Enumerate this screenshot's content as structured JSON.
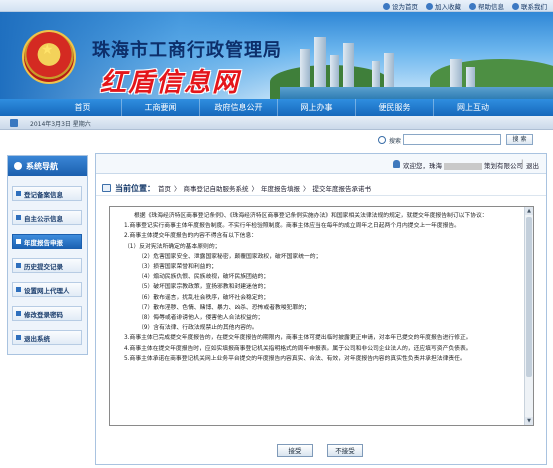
{
  "toplinks": [
    {
      "icon": "home-icon",
      "label": "设为首页"
    },
    {
      "icon": "star-icon",
      "label": "加入收藏"
    },
    {
      "icon": "help-icon",
      "label": "帮助信息"
    },
    {
      "icon": "contact-icon",
      "label": "联系我们"
    }
  ],
  "banner": {
    "bureau_title": "珠海市工商行政管理局",
    "site_title": "红盾信息网"
  },
  "nav": [
    "首页",
    "工商要闻",
    "政府信息公开",
    "网上办事",
    "便民服务",
    "网上互动"
  ],
  "date_text": "2014年3月3日 星期六",
  "search": {
    "label": "搜索",
    "button": "搜 索"
  },
  "sidebar": {
    "title": "系统导航",
    "items": [
      {
        "label": "登记备案信息",
        "active": false
      },
      {
        "label": "自主公示信息",
        "active": false
      },
      {
        "label": "年度报告申报",
        "active": true
      },
      {
        "label": "历史提交记录",
        "active": false
      },
      {
        "label": "设置网上代理人",
        "active": false
      },
      {
        "label": "修改登录密码",
        "active": false
      },
      {
        "label": "退出系统",
        "active": false
      }
    ]
  },
  "welcome": {
    "prefix": "欢迎您，珠海",
    "suffix": "策划有限公司",
    "separator": "|",
    "logout": "退出"
  },
  "breadcrumb": {
    "label": "当前位置：",
    "items": [
      "首页",
      "商事登记自助服务系统",
      "年度报告填报",
      "提交年度报告承诺书"
    ],
    "separator": "〉"
  },
  "notice": {
    "lines": [
      {
        "level": 0,
        "text": "根据《珠海经济特区商事登记条例》、《珠海经济特区商事登记条例实施办法》和国家相关法律法规的规定，就提交年度报告制订以下协议："
      },
      {
        "level": 1,
        "text": "1.商事登记实行商事主体年度报告制度。不实行年检验照制度。商事主体应当在每年的成立周年之日起两个月内提交上一年度报告。"
      },
      {
        "level": 1,
        "text": "2.商事主体提交年度报告的内容不得含有以下信息："
      },
      {
        "level": 1,
        "text": "（1）反对宪法所确定的基本原则的；"
      },
      {
        "level": 2,
        "text": "（2）危害国家安全、泄露国家秘密，颠覆国家政权，破坏国家统一的；"
      },
      {
        "level": 2,
        "text": "（3）损害国家荣誉和利益的；"
      },
      {
        "level": 2,
        "text": "（4）煽动民族仇恨、民族歧视，破坏民族团结的；"
      },
      {
        "level": 2,
        "text": "（5）破坏国家宗教政策，宣扬邪教和封建迷信的；"
      },
      {
        "level": 2,
        "text": "（6）散布谣言，扰乱社会秩序，破坏社会稳定的；"
      },
      {
        "level": 2,
        "text": "（7）散布淫秽、色情、赌博、暴力、凶杀、恐怖或者教唆犯罪的；"
      },
      {
        "level": 2,
        "text": "（8）侮辱或者诽谤他人，侵害他人合法权益的；"
      },
      {
        "level": 2,
        "text": "（9）含有法律、行政法规禁止的其他内容的。"
      },
      {
        "level": 1,
        "text": "3.商事主体已完成提交年度报告的，在提交年度报告的期限内，商事主体可提出临时披露更正申请，对本年已提交的年度报告进行修正。"
      },
      {
        "level": 1,
        "text": "4.商事主体在提交年度报告时，应如实填报商事登记机关指明格式的周年申报表。属于公司和非公司企业法人的，还应填写资产负债表。"
      },
      {
        "level": 1,
        "text": "5.商事主体承诺在商事登记机关网上业务平台提交的年度报告内容真实、合法、有效，对年度报告内容的真实性负责并承担法律责任。"
      }
    ]
  },
  "buttons": {
    "accept": "接受",
    "decline": "不接受"
  }
}
